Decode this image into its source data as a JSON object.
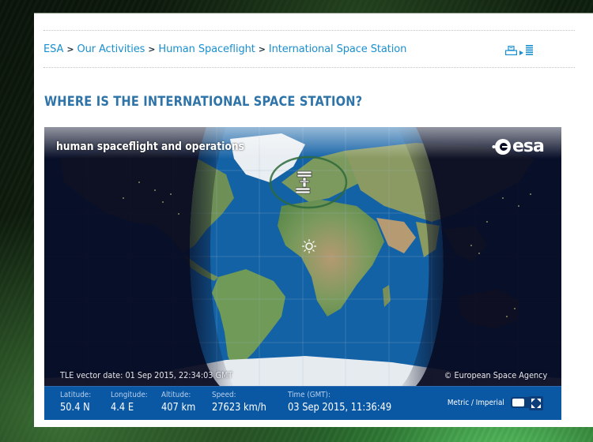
{
  "breadcrumb": [
    {
      "label": "ESA"
    },
    {
      "label": "Our Activities"
    },
    {
      "label": "Human Spaceflight"
    },
    {
      "label": "International Space Station"
    }
  ],
  "breadcrumb_separator": ">",
  "toolbar": {
    "print_icon": "printer-icon",
    "arrow_icon": "arrow-right-icon",
    "list_icon": "text-list-icon"
  },
  "page": {
    "title": "WHERE IS THE INTERNATIONAL SPACE STATION?"
  },
  "map": {
    "banner_title": "human spaceflight and operations",
    "logo_text": "esa",
    "tle_vector_date": "TLE vector date: 01 Sep 2015, 22:34:03 GMT",
    "copyright": "© European Space Agency",
    "iss_marker_icon": "iss-icon",
    "sun_marker_icon": "sun-icon",
    "colors": {
      "ocean": "#1462a6",
      "night": "#070a20",
      "land": "#6f9a5a",
      "visibility_ring": "#2e6a3a"
    }
  },
  "info": {
    "latitude": {
      "label": "Latitude:",
      "value": "50.4 N"
    },
    "longitude": {
      "label": "Longitude:",
      "value": "4.4 E"
    },
    "altitude": {
      "label": "Altitude:",
      "value": "407 km"
    },
    "speed": {
      "label": "Speed:",
      "value": "27623 km/h"
    },
    "time": {
      "label": "Time (GMT):",
      "value": "03 Sep 2015, 11:36:49"
    },
    "unit_toggle_label": "Metric / Imperial",
    "unit_toggle_state": "Metric",
    "fullscreen_icon": "fullscreen-icon",
    "bar_color": "#0a57a4"
  },
  "colors": {
    "link": "#1a8fd0",
    "title": "#2f74a8"
  }
}
